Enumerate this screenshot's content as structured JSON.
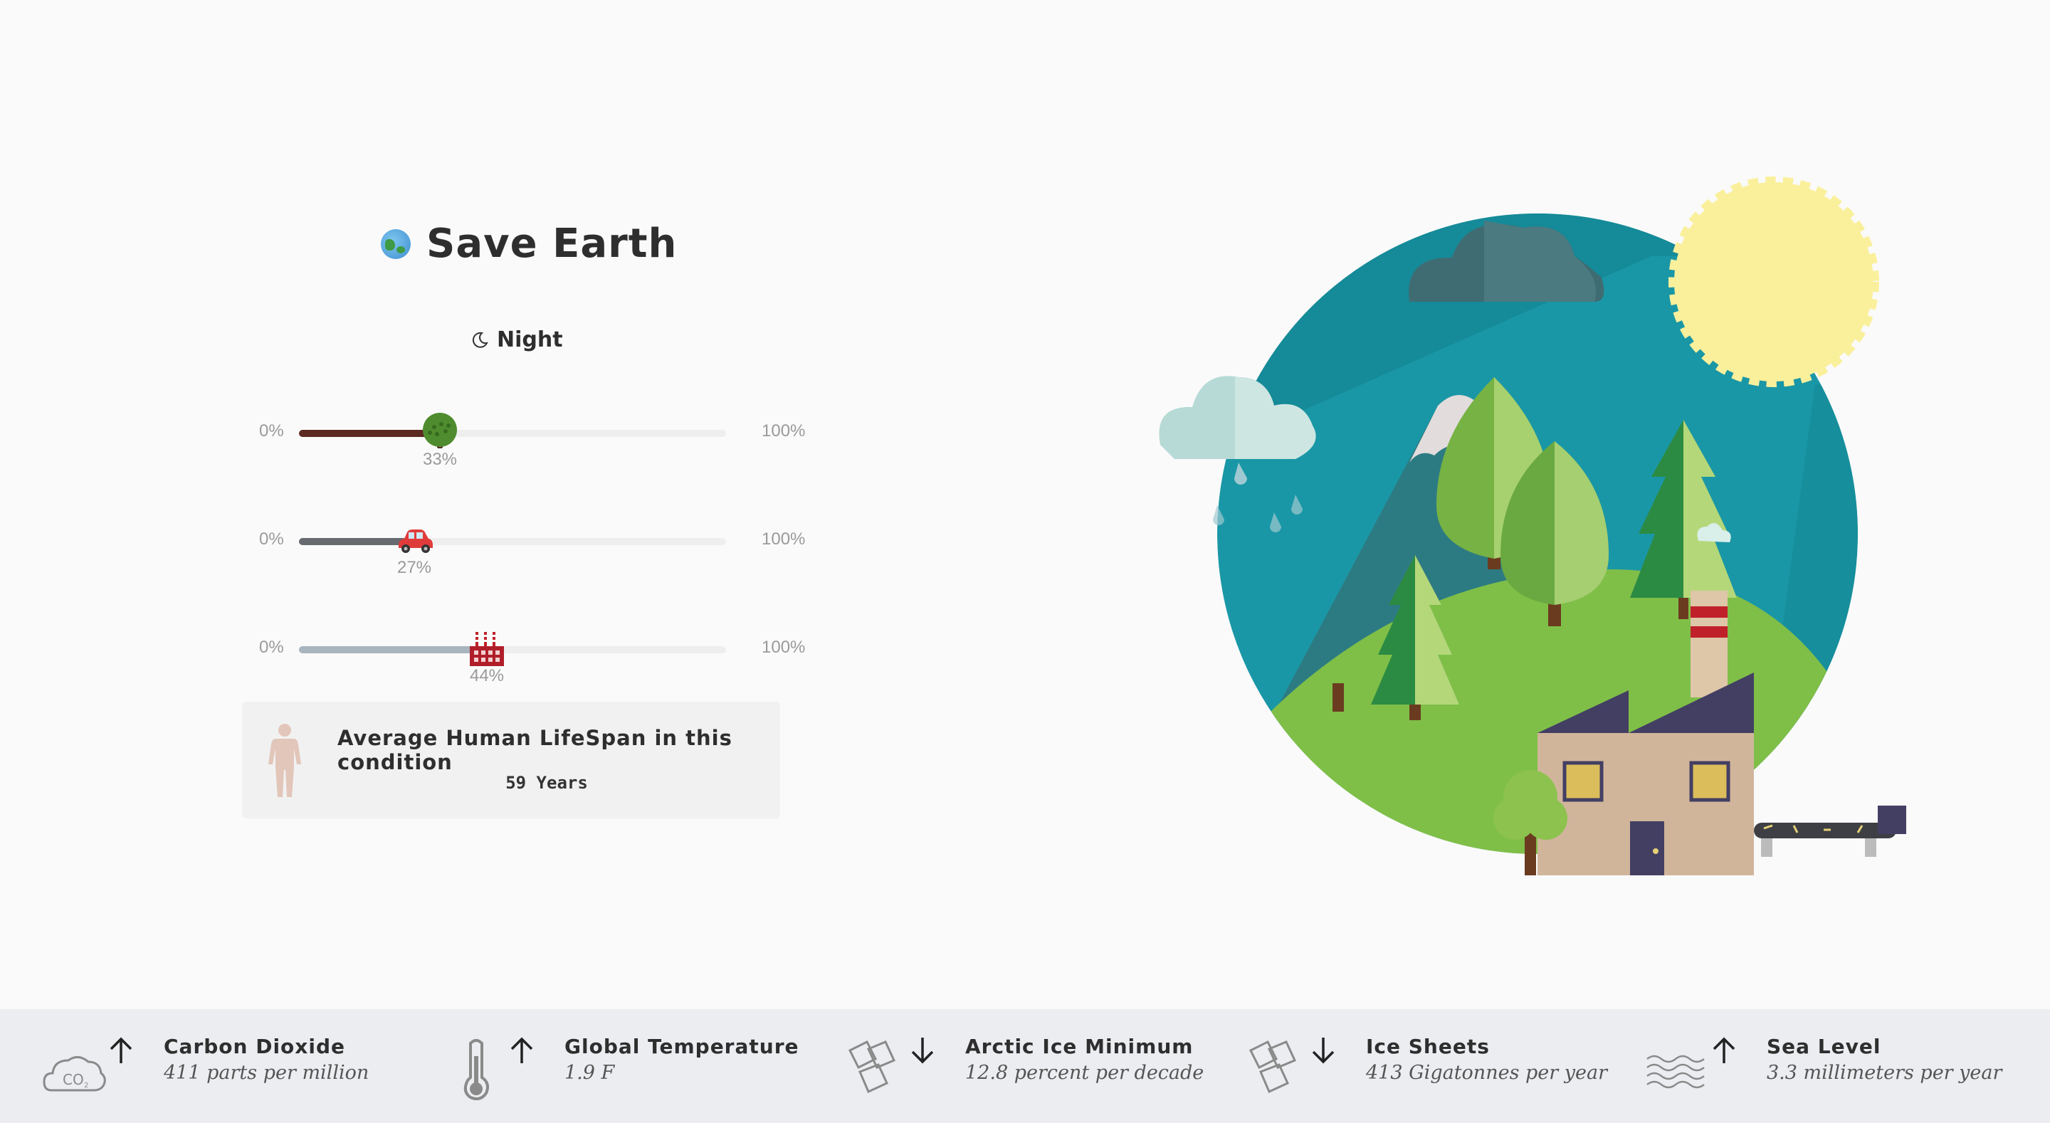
{
  "header": {
    "title": "Save Earth",
    "mode_label": "Night",
    "globe_icon": "earth-globe-icon",
    "mode_icon": "moon-icon"
  },
  "sliders": [
    {
      "id": "trees",
      "icon": "tree-icon",
      "min_label": "0%",
      "max_label": "100%",
      "value": 33,
      "value_label": "33%",
      "fill_color": "#5b2a22"
    },
    {
      "id": "cars",
      "icon": "car-icon",
      "min_label": "0%",
      "max_label": "100%",
      "value": 27,
      "value_label": "27%",
      "fill_color": "#666a70"
    },
    {
      "id": "factories",
      "icon": "factory-icon",
      "min_label": "0%",
      "max_label": "100%",
      "value": 44,
      "value_label": "44%",
      "fill_color": "#a8b4be"
    }
  ],
  "lifespan": {
    "label": "Average Human LifeSpan in this condition",
    "value": "59 Years",
    "icon": "human-figure-icon"
  },
  "stats": [
    {
      "icon": "co2-cloud-icon",
      "trend": "up",
      "name": "Carbon Dioxide",
      "value": "411 parts per million"
    },
    {
      "icon": "thermometer-icon",
      "trend": "up",
      "name": "Global Temperature",
      "value": "1.9 F"
    },
    {
      "icon": "ice-cubes-icon",
      "trend": "down",
      "name": "Arctic Ice Minimum",
      "value": "12.8 percent per decade"
    },
    {
      "icon": "ice-cubes-icon",
      "trend": "down",
      "name": "Ice Sheets",
      "value": "413 Gigatonnes per year"
    },
    {
      "icon": "waves-icon",
      "trend": "up",
      "name": "Sea Level",
      "value": "3.3 millimeters per year"
    }
  ],
  "colors": {
    "background": "#fafafa",
    "sky": "#1a97a6",
    "hill": "#7fbf48",
    "sun": "#faf09c",
    "footer": "#ebedf0"
  }
}
